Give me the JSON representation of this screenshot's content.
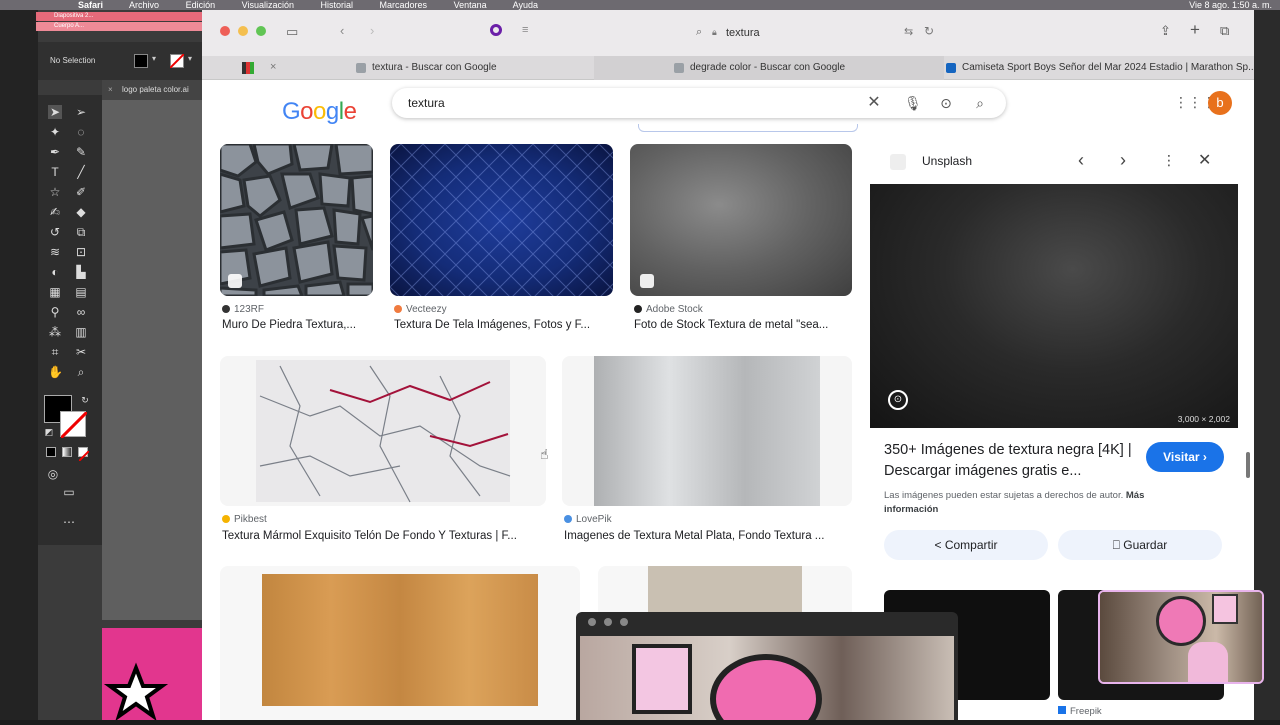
{
  "menubar": {
    "app": "Safari",
    "items": [
      "Archivo",
      "Edición",
      "Visualización",
      "Historial",
      "Marcadores",
      "Ventana",
      "Ayuda"
    ],
    "clock": "Vie 8 ago.  1:50 a. m."
  },
  "illustrator": {
    "pink_tabs": [
      "Diapositiva 2...",
      "Cuerpo A..."
    ],
    "selection_label": "No Selection",
    "doc_tab": "logo paleta color.ai"
  },
  "safari": {
    "address": "textura",
    "tabs": [
      {
        "label": "textura - Buscar con Google",
        "favicon_color": "#9aa0a6"
      },
      {
        "label": "degrade color - Buscar con Google",
        "favicon_color": "#9aa0a6"
      },
      {
        "label": "Camiseta Sport Boys Señor del Mar 2024 Estadio | Marathon Sp...",
        "favicon_color": "#1565c0"
      }
    ]
  },
  "google": {
    "logo": "Google",
    "query": "textura",
    "avatar_letter": "b",
    "results": [
      {
        "source": "123RF",
        "title": "Muro De Piedra Textura,...",
        "dot": "#333333"
      },
      {
        "source": "Vecteezy",
        "title": "Textura De Tela Imágenes, Fotos y F...",
        "dot": "#f07b3f"
      },
      {
        "source": "Adobe Stock",
        "title": "Foto de Stock Textura de metal \"sea...",
        "dot": "#222222"
      },
      {
        "source": "Pikbest",
        "title": "Textura Mármol Exquisito Telón De Fondo Y Texturas | F...",
        "dot": "#f5b301"
      },
      {
        "source": "LovePik",
        "title": "Imagenes de Textura Metal Plata, Fondo Textura ...",
        "dot": "#4a90e2"
      }
    ]
  },
  "panel": {
    "source": "Unsplash",
    "dimensions": "3,000 × 2,002",
    "title": "350+ Imágenes de textura negra [4K] | Descargar imágenes gratis e...",
    "visit_label": "Visitar",
    "note_prefix": "Las imágenes pueden estar sujetas a derechos de autor.",
    "note_link": "Más información",
    "share_label": "Compartir",
    "save_label": "Guardar",
    "related_source": "Freepik"
  }
}
